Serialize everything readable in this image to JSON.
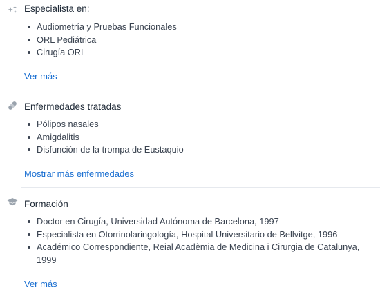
{
  "sections": [
    {
      "title": "Especialista en:",
      "icon": "sparkle-stars-icon",
      "items": [
        "Audiometría y Pruebas Funcionales",
        "ORL Pediátrica",
        "Cirugía ORL"
      ],
      "link": "Ver más"
    },
    {
      "title": "Enfermedades tratadas",
      "icon": "bandage-icon",
      "items": [
        "Pólipos nasales",
        "Amigdalitis",
        "Disfunción de la trompa de Eustaquio"
      ],
      "link": "Mostrar más enfermedades"
    },
    {
      "title": "Formación",
      "icon": "graduation-cap-icon",
      "items": [
        "Doctor en Cirugía, Universidad Autónoma de Barcelona, 1997",
        "Especialista en Otorrinolaringología, Hospital Universitario de Bellvitge, 1996",
        "Académico Correspondiente, Reial Acadèmia de Medicina i Cirurgia de Catalunya, 1999"
      ],
      "link": "Ver más"
    }
  ],
  "colors": {
    "link": "#1a6fd1",
    "icon": "#9aa3ad",
    "divider": "#e6e9ee"
  }
}
